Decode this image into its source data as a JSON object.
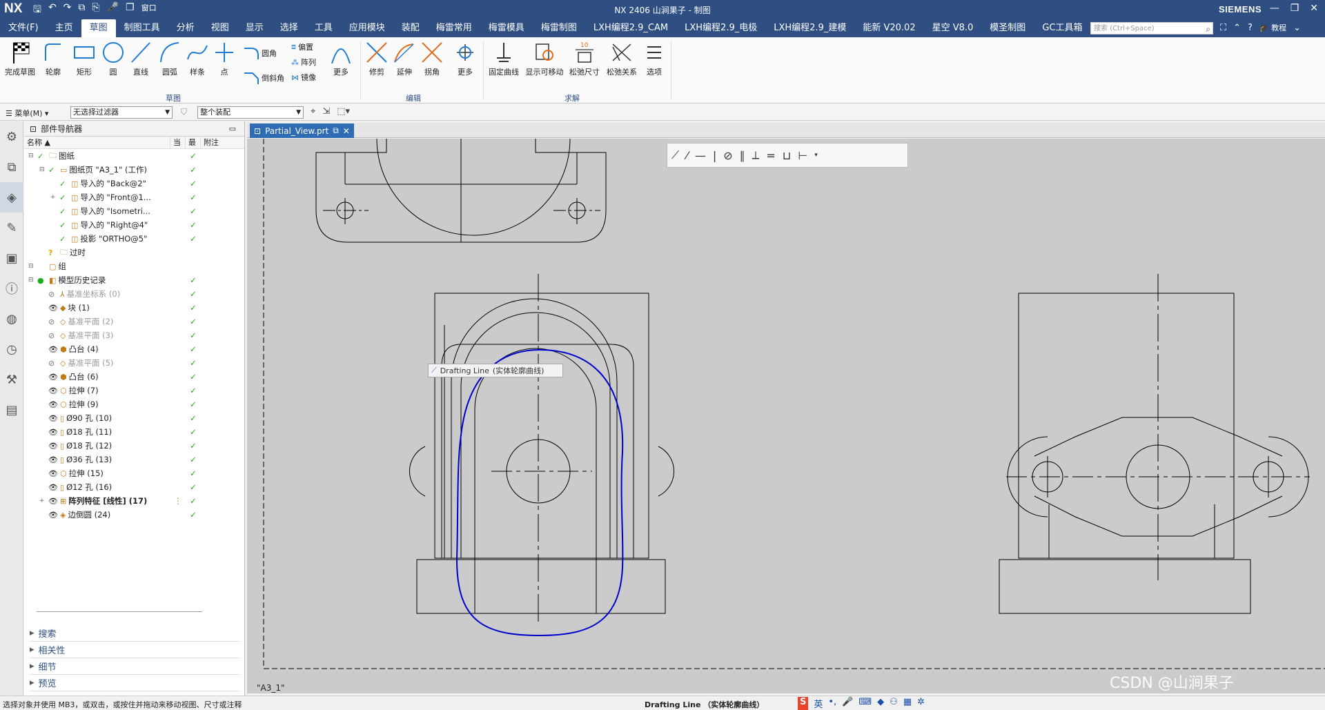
{
  "titlebar": {
    "logo": "NX",
    "title": "NX 2406 山涧果子 - 制图",
    "brand": "SIEMENS",
    "window_menu": "窗口"
  },
  "menubar": {
    "items": [
      "文件(F)",
      "主页",
      "草图",
      "制图工具",
      "分析",
      "视图",
      "显示",
      "选择",
      "工具",
      "应用模块",
      "装配",
      "梅雷常用",
      "梅雷模具",
      "梅雷制图",
      "LXH编程2.9_CAM",
      "LXH编程2.9_电极",
      "LXH编程2.9_建模",
      "能新 V20.02",
      "星空 V8.0",
      "模圣制图",
      "GC工具箱"
    ],
    "active_index": 2,
    "search_placeholder": "搜索 (Ctrl+Space)",
    "tutorial": "教程"
  },
  "ribbon": {
    "sketch_buttons": [
      "完成草图",
      "轮廓",
      "矩形",
      "圆",
      "直线",
      "圆弧",
      "样条",
      "点"
    ],
    "sketch_small": [
      "圆角",
      "倒斜角",
      "偏置",
      "阵列",
      "镜像"
    ],
    "sketch_more": "更多",
    "edit_buttons": [
      "修剪",
      "延伸",
      "拐角"
    ],
    "edit_more": "更多",
    "solve_buttons": [
      "固定曲线",
      "显示可移动",
      "松弛尺寸",
      "松弛关系",
      "选项"
    ],
    "groups": [
      "草图",
      "编辑",
      "求解"
    ]
  },
  "filterbar": {
    "menu": "菜单(M)",
    "filter": "无选择过滤器",
    "scope": "整个装配"
  },
  "navigator": {
    "title": "部件导航器",
    "columns": [
      "名称",
      "当",
      "最",
      "附注"
    ],
    "rows": [
      {
        "label": "图纸",
        "indent": 0,
        "icon": "folder",
        "check": true,
        "latest": true,
        "dim": false,
        "vis": "none"
      },
      {
        "label": "图纸页 \"A3_1\" (工作)",
        "indent": 1,
        "icon": "sheet",
        "check": true,
        "latest": true,
        "dim": false,
        "vis": "none"
      },
      {
        "label": "导入的 \"Back@2\"",
        "indent": 2,
        "icon": "view",
        "check": true,
        "latest": true,
        "dim": false,
        "vis": "none"
      },
      {
        "label": "导入的 \"Front@1...",
        "indent": 2,
        "icon": "view",
        "check": true,
        "latest": true,
        "dim": false,
        "vis": "none"
      },
      {
        "label": "导入的 \"Isometri...",
        "indent": 2,
        "icon": "view",
        "check": true,
        "latest": true,
        "dim": false,
        "vis": "none"
      },
      {
        "label": "导入的 \"Right@4\"",
        "indent": 2,
        "icon": "view",
        "check": true,
        "latest": true,
        "dim": false,
        "vis": "none"
      },
      {
        "label": "投影 \"ORTHO@5\"",
        "indent": 2,
        "icon": "view",
        "check": true,
        "latest": true,
        "dim": false,
        "vis": "none"
      },
      {
        "label": "过时",
        "indent": 1,
        "icon": "folder",
        "check": false,
        "latest": false,
        "dim": false,
        "vis": "question"
      },
      {
        "label": "组",
        "indent": 0,
        "icon": "group",
        "check": false,
        "latest": false,
        "dim": false,
        "vis": "none"
      },
      {
        "label": "模型历史记录",
        "indent": 0,
        "icon": "history",
        "check": false,
        "latest": true,
        "dim": false,
        "vis": "green"
      },
      {
        "label": "基准坐标系 (0)",
        "indent": 1,
        "icon": "csys",
        "check": false,
        "latest": true,
        "dim": true,
        "vis": "hidden"
      },
      {
        "label": "块 (1)",
        "indent": 1,
        "icon": "block",
        "check": false,
        "latest": true,
        "dim": false,
        "vis": "eye"
      },
      {
        "label": "基准平面 (2)",
        "indent": 1,
        "icon": "plane",
        "check": false,
        "latest": true,
        "dim": true,
        "vis": "hidden"
      },
      {
        "label": "基准平面 (3)",
        "indent": 1,
        "icon": "plane",
        "check": false,
        "latest": true,
        "dim": true,
        "vis": "hidden"
      },
      {
        "label": "凸台 (4)",
        "indent": 1,
        "icon": "boss",
        "check": false,
        "latest": true,
        "dim": false,
        "vis": "eye"
      },
      {
        "label": "基准平面 (5)",
        "indent": 1,
        "icon": "plane",
        "check": false,
        "latest": true,
        "dim": true,
        "vis": "hidden"
      },
      {
        "label": "凸台 (6)",
        "indent": 1,
        "icon": "boss",
        "check": false,
        "latest": true,
        "dim": false,
        "vis": "eye"
      },
      {
        "label": "拉伸 (7)",
        "indent": 1,
        "icon": "extrude",
        "check": false,
        "latest": true,
        "dim": false,
        "vis": "eye"
      },
      {
        "label": "拉伸 (9)",
        "indent": 1,
        "icon": "extrude",
        "check": false,
        "latest": true,
        "dim": false,
        "vis": "eye"
      },
      {
        "label": "Ø90 孔 (10)",
        "indent": 1,
        "icon": "hole",
        "check": false,
        "latest": true,
        "dim": false,
        "vis": "eye"
      },
      {
        "label": "Ø18 孔 (11)",
        "indent": 1,
        "icon": "hole",
        "check": false,
        "latest": true,
        "dim": false,
        "vis": "eye"
      },
      {
        "label": "Ø18 孔 (12)",
        "indent": 1,
        "icon": "hole",
        "check": false,
        "latest": true,
        "dim": false,
        "vis": "eye"
      },
      {
        "label": "Ø36 孔 (13)",
        "indent": 1,
        "icon": "hole",
        "check": false,
        "latest": true,
        "dim": false,
        "vis": "eye"
      },
      {
        "label": "拉伸 (15)",
        "indent": 1,
        "icon": "extrude",
        "check": false,
        "latest": true,
        "dim": false,
        "vis": "eye"
      },
      {
        "label": "Ø12 孔 (16)",
        "indent": 1,
        "icon": "hole",
        "check": false,
        "latest": true,
        "dim": false,
        "vis": "eye"
      },
      {
        "label": "阵列特征 [线性] (17)",
        "indent": 1,
        "icon": "pattern",
        "check": false,
        "latest": true,
        "dim": false,
        "vis": "eye"
      },
      {
        "label": "边倒圆 (24)",
        "indent": 1,
        "icon": "blend",
        "check": false,
        "latest": true,
        "dim": false,
        "vis": "eye"
      }
    ],
    "panels": [
      "搜索",
      "相关性",
      "细节",
      "预览"
    ]
  },
  "tab": {
    "label": "Partial_View.prt"
  },
  "canvas": {
    "tooltip_main": "Drafting Line",
    "tooltip_sub": "(实体轮廓曲线)",
    "sheet_label": "\"A3_1\""
  },
  "statusbar": {
    "left": "选择对象并使用 MB3，或双击，或按住并拖动来移动视图、尺寸或注释",
    "middle": "Drafting Line （实体轮廓曲线）"
  },
  "watermark": "CSDN @山涧果子",
  "colors": {
    "title_bg": "#2f4f83",
    "tab_bg": "#2f6cb4",
    "highlight_curve": "#0000cc",
    "canvas_bg": "#cbcbcb",
    "check_green": "#1cad1c"
  }
}
